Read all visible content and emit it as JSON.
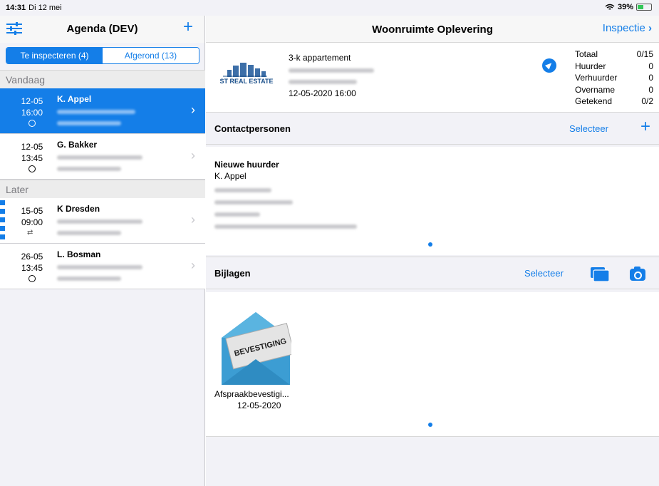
{
  "status_bar": {
    "time": "14:31",
    "date": "Di 12 mei",
    "battery": "39%"
  },
  "left": {
    "title": "Agenda (DEV)",
    "segments": [
      {
        "label": "Te inspecteren (4)",
        "active": true
      },
      {
        "label": "Afgerond (13)",
        "active": false
      }
    ],
    "sections": {
      "today": "Vandaag",
      "later": "Later"
    },
    "appointments": [
      {
        "day": "12-05",
        "time": "16:00",
        "name": "K. Appel",
        "selected": true
      },
      {
        "day": "12-05",
        "time": "13:45",
        "name": "G. Bakker",
        "selected": false
      },
      {
        "day": "15-05",
        "time": "09:00",
        "name": "K Dresden",
        "selected": false
      },
      {
        "day": "26-05",
        "time": "13:45",
        "name": "L. Bosman",
        "selected": false
      }
    ]
  },
  "right": {
    "title": "Woonruimte Oplevering",
    "next_label": "Inspectie",
    "logo_text": "ST REAL ESTATE",
    "property_type": "3-k appartement",
    "datetime": "12-05-2020 16:00",
    "stats": [
      {
        "label": "Totaal",
        "value": "0/15"
      },
      {
        "label": "Huurder",
        "value": "0"
      },
      {
        "label": "Verhuurder",
        "value": "0"
      },
      {
        "label": "Overname",
        "value": "0"
      },
      {
        "label": "Getekend",
        "value": "0/2"
      }
    ],
    "contacts": {
      "title": "Contactpersonen",
      "select_label": "Selecteer",
      "role": "Nieuwe huurder",
      "name": "K. Appel"
    },
    "attachments": {
      "title": "Bijlagen",
      "select_label": "Selecteer",
      "envelope_text": "BEVESTIGING",
      "file_name": "Afspraakbevestigi...",
      "file_date": "12-05-2020"
    }
  },
  "colors": {
    "accent": "#147ee8",
    "background": "#f2f2f7"
  }
}
